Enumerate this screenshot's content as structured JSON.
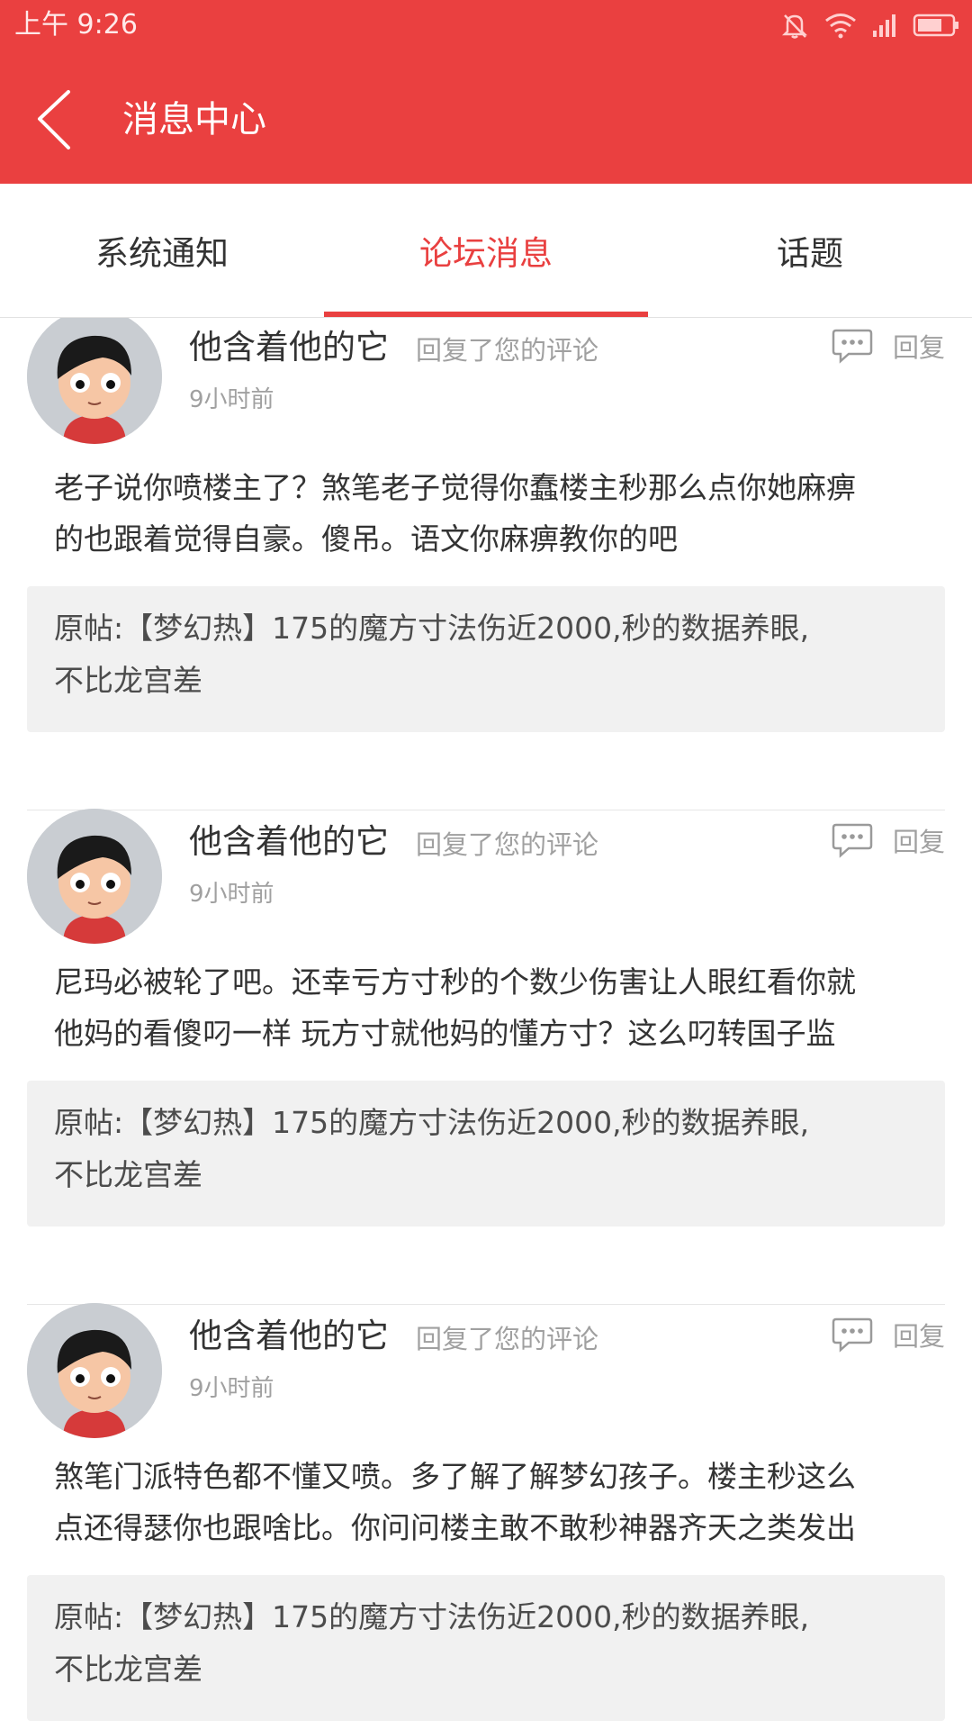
{
  "status": {
    "time": "上午 9:26"
  },
  "header": {
    "title": "消息中心"
  },
  "tabs": [
    {
      "label": "系统通知"
    },
    {
      "label": "论坛消息"
    },
    {
      "label": "话题"
    }
  ],
  "messages": [
    {
      "user": "他含着他的它",
      "action": "回复了您的评论",
      "time": "9小时前",
      "reply_label": "回复",
      "content_lines": [
        "老子说你喷楼主了？煞笔老子觉得你蠢楼主秒那么点你她麻痹",
        "的也跟着觉得自豪。傻吊。语文你麻痹教你的吧"
      ],
      "origin_lines": [
        "原帖:【梦幻热】175的魔方寸法伤近2000,秒的数据养眼,",
        "不比龙宫差"
      ]
    },
    {
      "user": "他含着他的它",
      "action": "回复了您的评论",
      "time": "9小时前",
      "reply_label": "回复",
      "content_lines": [
        "尼玛必被轮了吧。还幸亏方寸秒的个数少伤害让人眼红看你就",
        "他妈的看傻叼一样   玩方寸就他妈的懂方寸？这么叼转国子监"
      ],
      "origin_lines": [
        "原帖:【梦幻热】175的魔方寸法伤近2000,秒的数据养眼,",
        "不比龙宫差"
      ]
    },
    {
      "user": "他含着他的它",
      "action": "回复了您的评论",
      "time": "9小时前",
      "reply_label": "回复",
      "content_lines": [
        "煞笔门派特色都不懂又喷。多了解了解梦幻孩子。楼主秒这么",
        "点还得瑟你也跟啥比。你问问楼主敢不敢秒神器齐天之类发出"
      ],
      "origin_lines": [
        "原帖:【梦幻热】175的魔方寸法伤近2000,秒的数据养眼,",
        "不比龙宫差"
      ]
    }
  ]
}
